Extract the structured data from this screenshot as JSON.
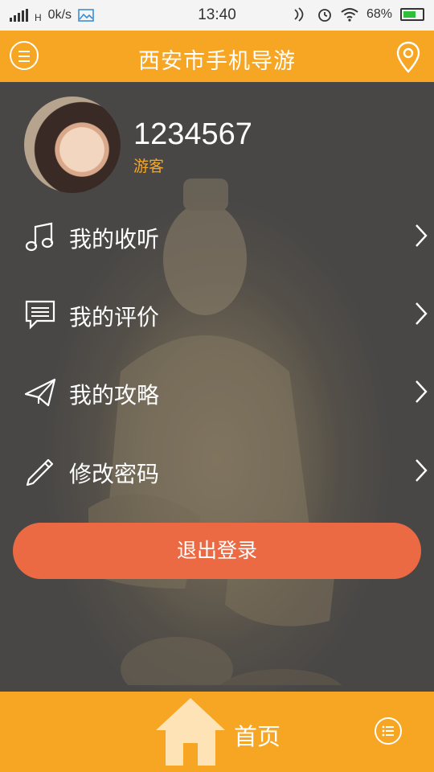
{
  "status_bar": {
    "network_type": "H",
    "speed": "0k/s",
    "time": "13:40",
    "battery_percent": "68%"
  },
  "header": {
    "title": "西安市手机导游"
  },
  "profile": {
    "username": "1234567",
    "role": "游客"
  },
  "menu": {
    "items": [
      {
        "label": "我的收听",
        "icon": "music-note-icon"
      },
      {
        "label": "我的评价",
        "icon": "comment-icon"
      },
      {
        "label": "我的攻略",
        "icon": "paper-plane-icon"
      },
      {
        "label": "修改密码",
        "icon": "pencil-icon"
      }
    ]
  },
  "logout_label": "退出登录",
  "bottom_bar": {
    "home_label": "首页"
  },
  "colors": {
    "accent": "#f6a623",
    "logout": "#ec6a43"
  }
}
